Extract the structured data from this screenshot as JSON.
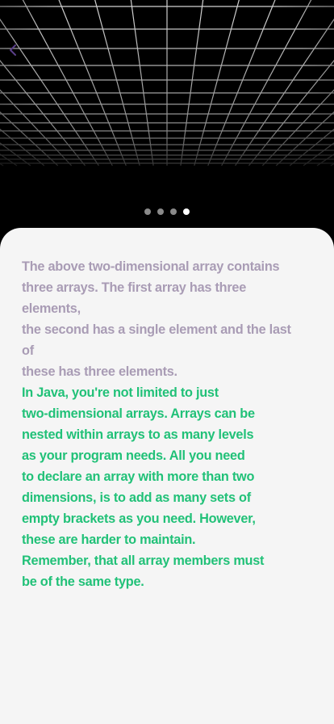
{
  "colors": {
    "purple_text": "#a99cb5",
    "green_text": "#21c178",
    "card_background": "#f5f5f5",
    "hero_background": "#000000",
    "dot_active": "#ffffff",
    "dot_inactive": "#8a8a8a"
  },
  "header": {
    "back_icon": "chevron-left-icon"
  },
  "pager": {
    "total_pages": 4,
    "active_page": 4
  },
  "content": {
    "paragraph_1": "The above two-dimensional array contains\nthree arrays. The first array has three elements,\nthe second has a single element and the last of\nthese has three elements.",
    "paragraph_2": "In Java, you're not limited to just\ntwo-dimensional arrays. Arrays can be\nnested within arrays to as many levels\nas your program needs. All you need\nto declare an array with more than two\ndimensions, is to add as many sets of\nempty brackets as you need. However,\nthese are harder to maintain.\nRemember, that all array members must\nbe of the same type."
  }
}
